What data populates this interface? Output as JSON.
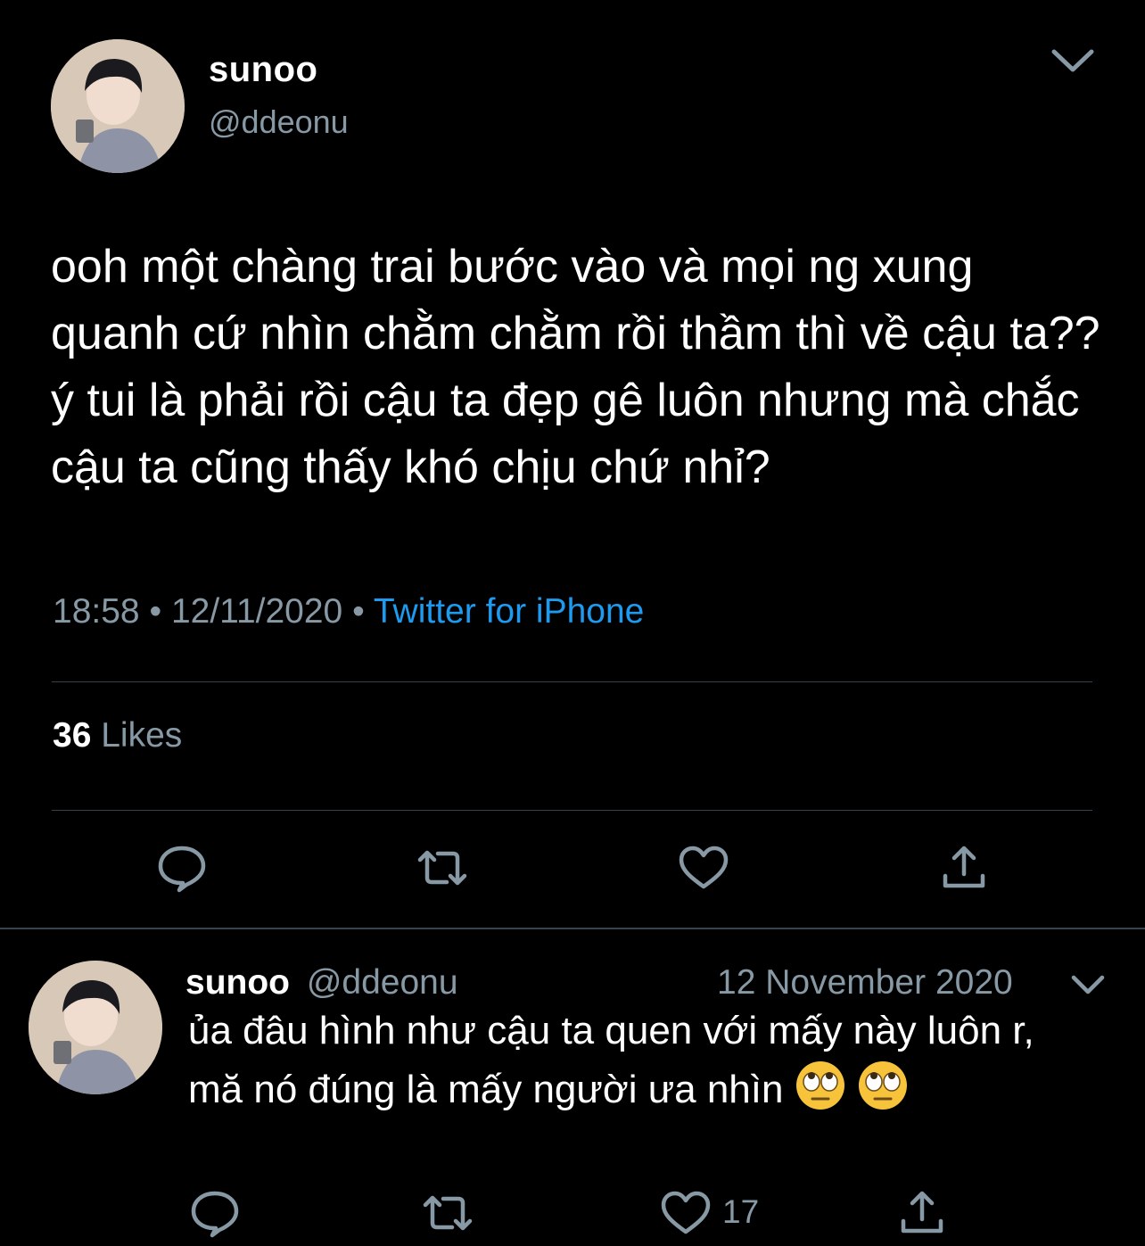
{
  "main_tweet": {
    "display_name": "sunoo",
    "handle": "@ddeonu",
    "text": "ooh một chàng trai bước vào và mọi ng xung quanh cứ nhìn chằm chằm rồi thầm thì về cậu ta?? ý tui là phải rồi cậu ta đẹp gê luôn nhưng mà chắc cậu ta cũng thấy khó chịu chứ nhỉ?",
    "time": "18:58",
    "date": "12/11/2020",
    "separator": "•",
    "source": "Twitter for iPhone",
    "likes_count": "36",
    "likes_label": "Likes",
    "icons": [
      "chevron-down-icon",
      "reply-icon",
      "retweet-icon",
      "like-icon",
      "share-icon"
    ]
  },
  "reply_tweet": {
    "display_name": "sunoo",
    "handle": "@ddeonu",
    "date": "12 November 2020",
    "text": "ủa đâu hình như cậu ta quen với mấy này luôn r, mă nó đúng là mấy người ưa nhìn",
    "emojis": [
      "face-with-rolling-eyes",
      "face-with-rolling-eyes"
    ],
    "like_count": "17",
    "icons": [
      "chevron-down-icon",
      "reply-icon",
      "retweet-icon",
      "like-icon",
      "share-icon"
    ]
  },
  "colors": {
    "background": "#000000",
    "primary_text": "#ffffff",
    "secondary_text": "#8899a6",
    "link": "#1d9bf0",
    "divider": "#38444d"
  }
}
